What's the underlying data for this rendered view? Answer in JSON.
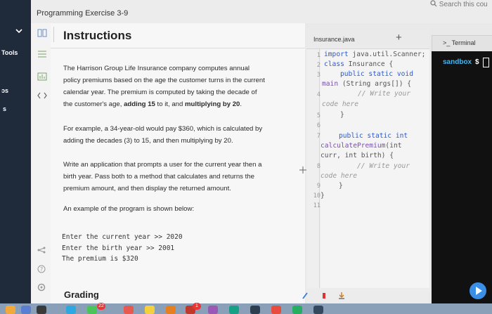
{
  "header": {
    "exercise_title": "Programming Exercise 3-9",
    "search_text": "Search this cou"
  },
  "left_sidebar": {
    "tools_label": "Tools",
    "partial_label_1": "ɔs",
    "partial_label_2": "s"
  },
  "instructions": {
    "title": "Instructions",
    "para1_a": "The Harrison Group Life Insurance company computes annual",
    "para1_b": "policy premiums based on the age the customer turns in the current",
    "para1_c": "calendar year. The premium is computed by taking the decade of",
    "para1_d_pre": "the customer's age, ",
    "para1_d_b1": "adding 15",
    "para1_d_mid": " to it, and ",
    "para1_d_b2": "multiplying by 20",
    "para1_d_post": ".",
    "para2_a": "For example, a 34-year-old would pay $360, which is calculated by",
    "para2_b": "adding the decades (3) to 15, and then multiplying by 20.",
    "para3_a": "Write an application that prompts a user for the current year then a",
    "para3_b": "birth year. Pass both to a method that calculates and returns the",
    "para3_c": "premium amount, and then display the returned amount.",
    "para4": "An example of the program is shown below:",
    "sample_lines": [
      "Enter the current year >> 2020",
      "Enter the birth year >> 2001",
      "The premium is $320"
    ],
    "grading": "Grading"
  },
  "editor": {
    "filename": "Insurance.java",
    "plus": "+",
    "line_numbers": [
      "1",
      "2",
      "3",
      "4",
      "5",
      "6",
      "7",
      "8",
      "9",
      "10",
      "11"
    ],
    "code": {
      "l1_kw": "import",
      "l1_rest": " java.util.Scanner;",
      "l2_kw": "class",
      "l2_rest": " Insurance {",
      "l3_kw": "public static void",
      "l3b_fn": "main",
      "l3b_rest": " (String args[]) {",
      "l4_cm": "// Write your",
      "l4b_cm": "code here",
      "l5": "}",
      "l7_kw": "public static int",
      "l7b_fn": "calculatePremium",
      "l7b_rest": "(int",
      "l7c": "curr, int birth) {",
      "l8_cm": "// Write your",
      "l8b_cm": "code here",
      "l9": "}",
      "l10": "}"
    }
  },
  "terminal": {
    "tab_label": "Terminal",
    "prompt": "sandbox",
    "dollar": "$"
  },
  "dock": {
    "badge_1": "22",
    "badge_2": "1"
  },
  "colors": {
    "terminal_bg": "#111111",
    "prompt": "#4ab3e8",
    "keyword": "#2a5ad0",
    "play_button": "#3a8ee6"
  }
}
